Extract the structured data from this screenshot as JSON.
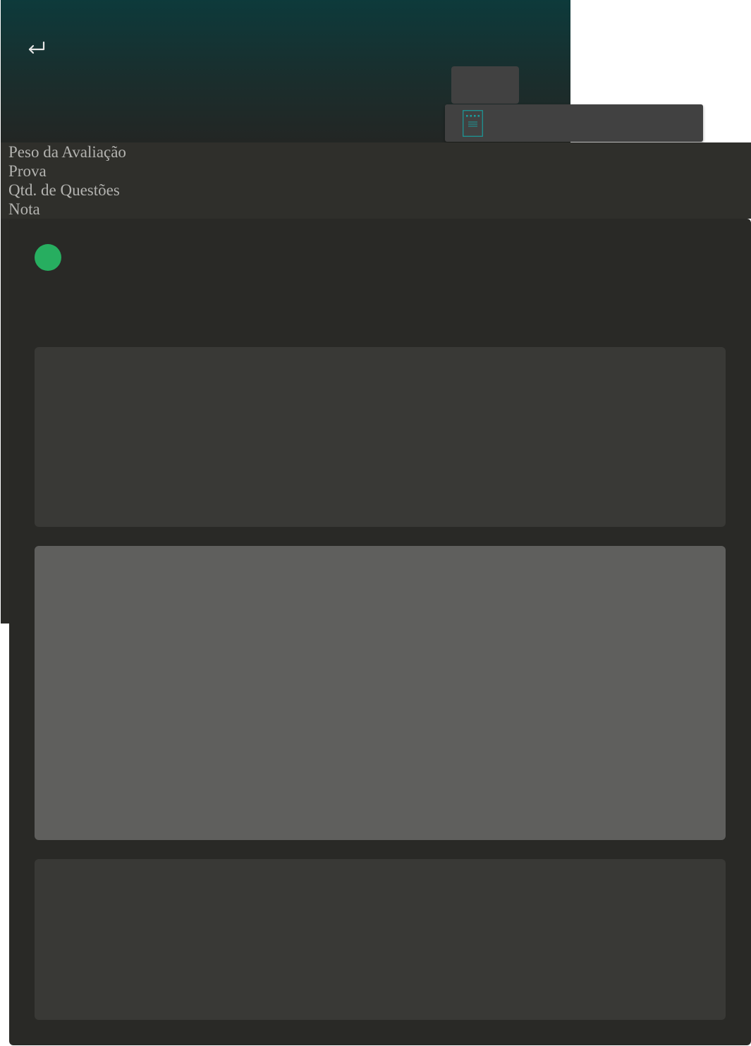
{
  "header": {
    "back_icon": "return-arrow-icon",
    "document_icon": "document-list-icon",
    "accent_color": "#1a9c9c"
  },
  "evaluation": {
    "labels": [
      "Peso da Avaliação",
      "Prova",
      "Qtd. de Questões",
      "Nota"
    ]
  },
  "status": {
    "color": "#27ae60"
  }
}
